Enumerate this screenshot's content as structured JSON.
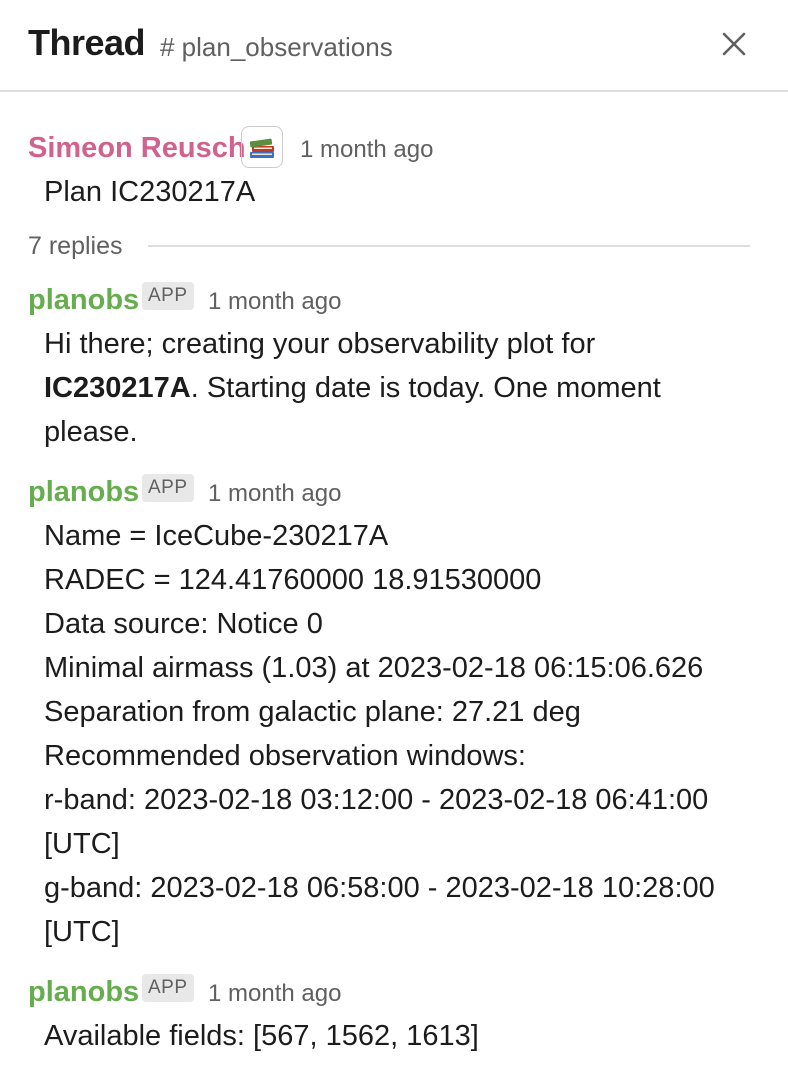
{
  "header": {
    "title": "Thread",
    "channel": "# plan_observations"
  },
  "parent_message": {
    "author": "Simeon Reusch",
    "status_emoji": "books-emoji",
    "timestamp": "1 month ago",
    "text": "Plan IC230217A"
  },
  "replies": {
    "label": "7 replies"
  },
  "messages": [
    {
      "author": "planobs",
      "badge": "APP",
      "timestamp": "1 month ago",
      "text_part1": "Hi there; creating your observability plot for",
      "text_bold": "IC230217A",
      "text_part2": ". Starting date is today. One moment",
      "text_part3": "please."
    },
    {
      "author": "planobs",
      "badge": "APP",
      "timestamp": "1 month ago",
      "lines": [
        "Name = IceCube-230217A",
        "RADEC = 124.41760000 18.91530000",
        "Data source: Notice 0",
        "Minimal airmass (1.03) at 2023-02-18 06:15:06.626",
        "Separation from galactic plane: 27.21 deg",
        "Recommended observation windows:",
        "r-band: 2023-02-18 03:12:00 - 2023-02-18 06:41:00",
        "[UTC]",
        "g-band: 2023-02-18 06:58:00 - 2023-02-18 10:28:00",
        "[UTC]"
      ]
    },
    {
      "author": "planobs",
      "badge": "APP",
      "timestamp": "1 month ago",
      "text": "Available fields: [567, 1562, 1613]"
    }
  ],
  "colors": {
    "parent_author": "#d0628d",
    "bot_author": "#65ad4e",
    "muted_text": "#616061",
    "divider": "#dddddd"
  }
}
